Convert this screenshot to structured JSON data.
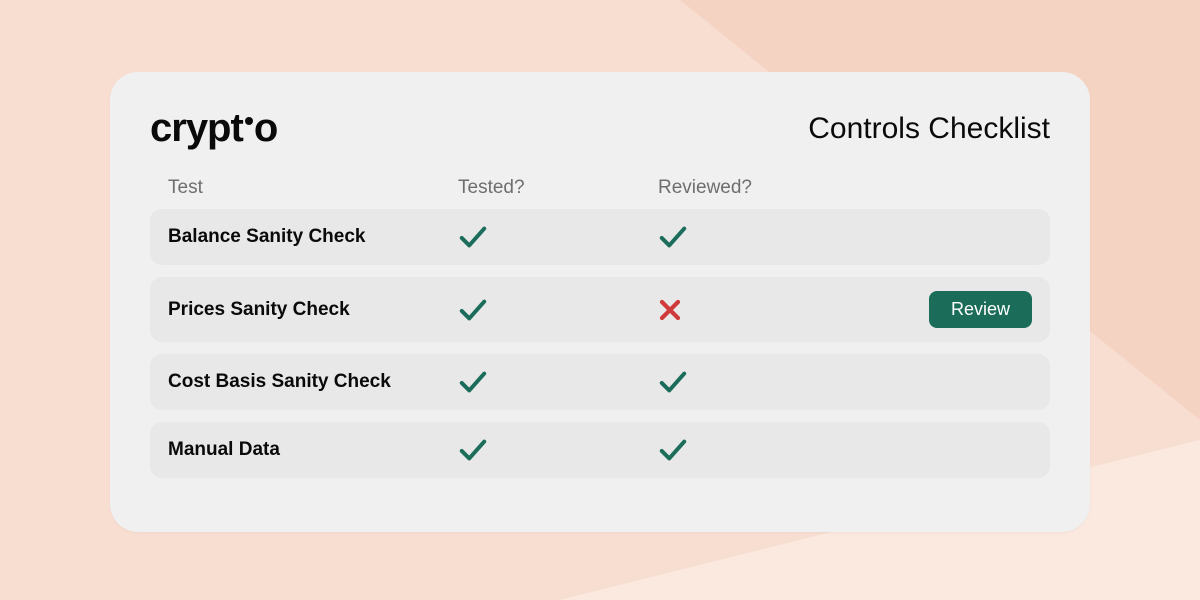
{
  "brand": "cryptio",
  "title": "Controls Checklist",
  "columns": {
    "test": "Test",
    "tested": "Tested?",
    "reviewed": "Reviewed?"
  },
  "colors": {
    "accent": "#1b6d5a",
    "fail": "#cf3a3a",
    "card": "#f0f0f0",
    "row": "#e8e8e8",
    "bg": "#f8ded1"
  },
  "rows": [
    {
      "name": "Balance Sanity Check",
      "tested": true,
      "reviewed": true,
      "action": null
    },
    {
      "name": "Prices Sanity Check",
      "tested": true,
      "reviewed": false,
      "action": "Review"
    },
    {
      "name": "Cost Basis Sanity Check",
      "tested": true,
      "reviewed": true,
      "action": null
    },
    {
      "name": "Manual Data",
      "tested": true,
      "reviewed": true,
      "action": null
    }
  ],
  "buttons": {
    "review": "Review"
  }
}
